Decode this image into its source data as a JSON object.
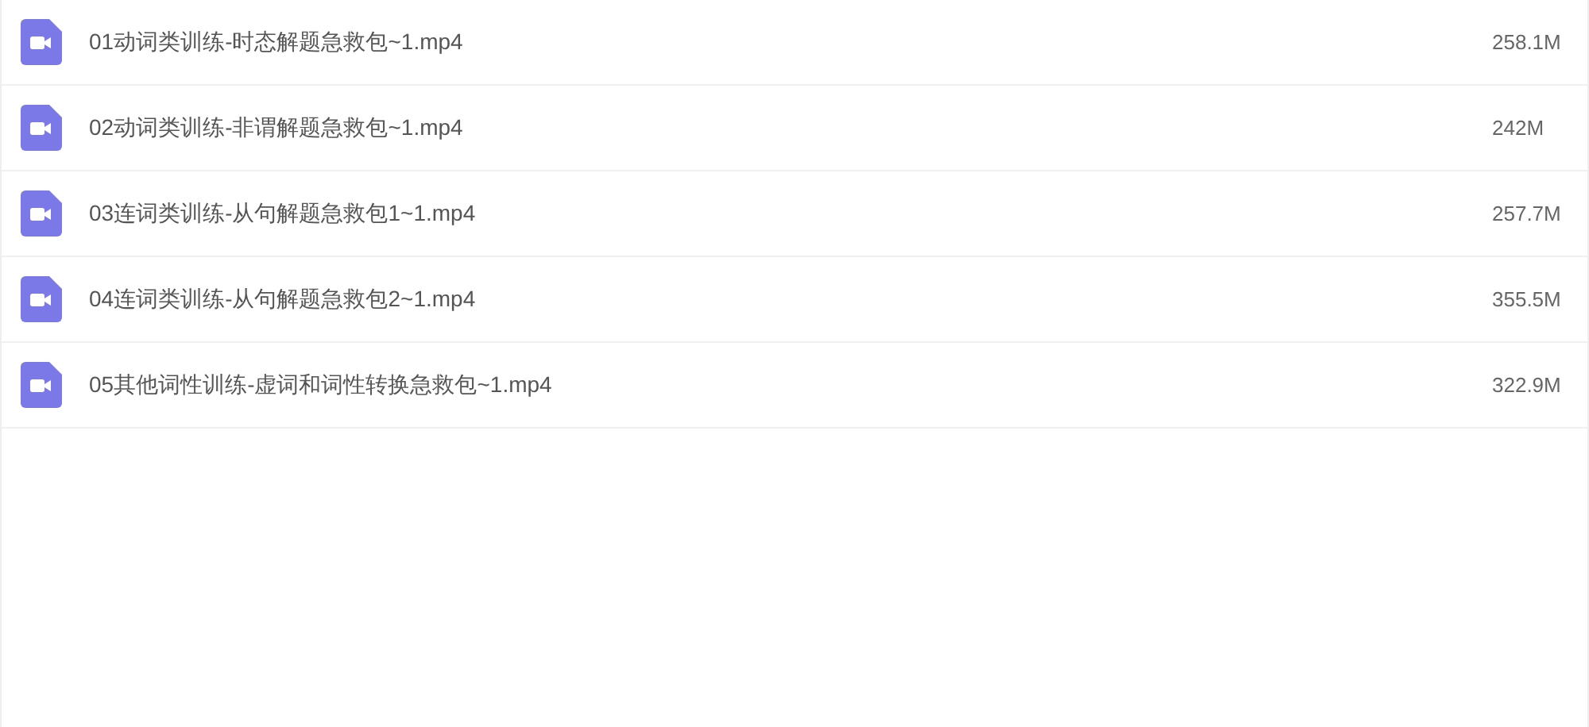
{
  "files": [
    {
      "name": "01动词类训练-时态解题急救包~1.mp4",
      "size": "258.1M"
    },
    {
      "name": "02动词类训练-非谓解题急救包~1.mp4",
      "size": "242M"
    },
    {
      "name": "03连词类训练-从句解题急救包1~1.mp4",
      "size": "257.7M"
    },
    {
      "name": "04连词类训练-从句解题急救包2~1.mp4",
      "size": "355.5M"
    },
    {
      "name": "05其他词性训练-虚词和词性转换急救包~1.mp4",
      "size": "322.9M"
    }
  ]
}
